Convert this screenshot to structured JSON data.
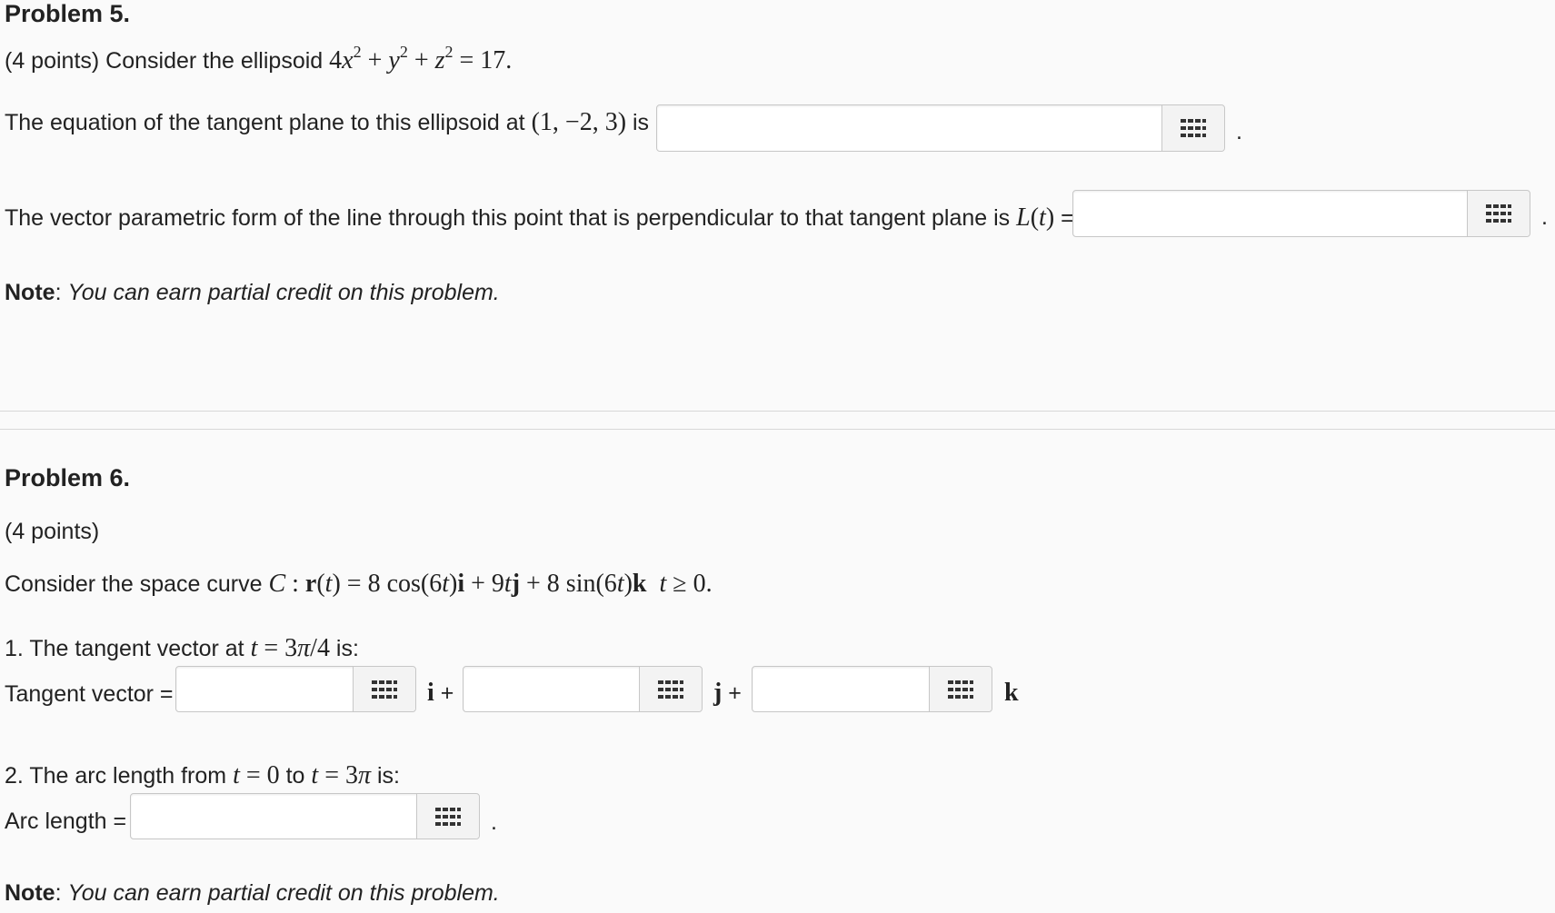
{
  "problem5": {
    "title": "Problem 5.",
    "intro_prefix": "(4 points) Consider the ellipsoid",
    "tangent_prefix": "The equation of the tangent plane to this ellipsoid at",
    "tangent_point": "(1, −2, 3)",
    "tangent_suffix": "is",
    "tangent_value": "",
    "line_prefix": "The vector parametric form of the line through this point that is perpendicular to that tangent plane is",
    "line_eq": "=",
    "line_value": "",
    "period": ".",
    "note_label": "Note",
    "note_text": "You can earn partial credit on this problem."
  },
  "problem6": {
    "title": "Problem 6.",
    "points": "(4 points)",
    "curve_prefix": "Consider the space curve",
    "q1_prefix": "1. The tangent vector at",
    "q1_suffix": "is:",
    "tangent_label": "Tangent vector =",
    "plus": "+",
    "i_value": "",
    "j_value": "",
    "k_value": "",
    "q2_prefix": "2. The arc length from",
    "q2_to": "to",
    "q2_suffix": "is:",
    "arc_label": "Arc length =",
    "arc_value": "",
    "period": ".",
    "note_label": "Note",
    "note_text": "You can earn partial credit on this problem."
  },
  "icons": {
    "palette": "grid-palette-icon"
  }
}
